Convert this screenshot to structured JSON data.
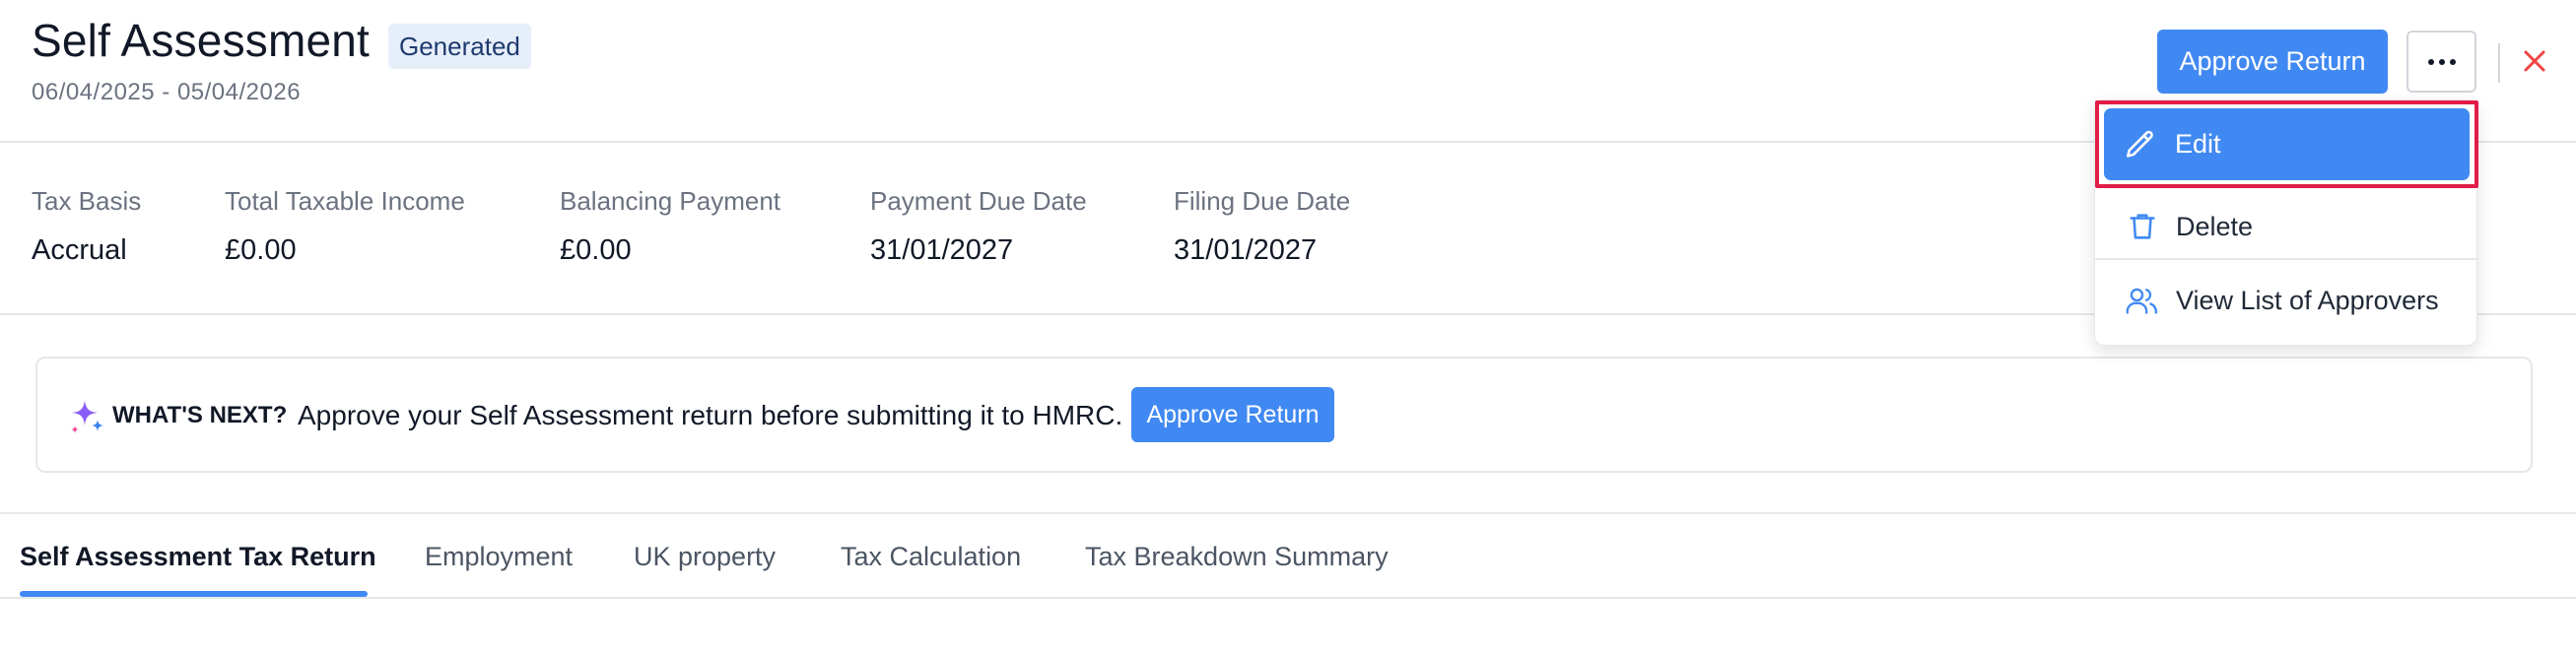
{
  "header": {
    "title": "Self Assessment",
    "status_badge": "Generated",
    "period": "06/04/2025 - 05/04/2026",
    "approve_button": "Approve Return",
    "more_icon": "more-horizontal-icon",
    "close_icon": "close-icon"
  },
  "stats": [
    {
      "label": "Tax Basis",
      "value": "Accrual"
    },
    {
      "label": "Total Taxable Income",
      "value": "£0.00"
    },
    {
      "label": "Balancing Payment",
      "value": "£0.00"
    },
    {
      "label": "Payment Due Date",
      "value": "31/01/2027"
    },
    {
      "label": "Filing Due Date",
      "value": "31/01/2027"
    }
  ],
  "banner": {
    "icon": "sparkle-icon",
    "heading": "WHAT'S NEXT?",
    "text": "Approve your Self Assessment return before submitting it to HMRC.",
    "button": "Approve Return"
  },
  "tabs": [
    {
      "label": "Self Assessment Tax Return",
      "active": true
    },
    {
      "label": "Employment",
      "active": false
    },
    {
      "label": "UK property",
      "active": false
    },
    {
      "label": "Tax Calculation",
      "active": false
    },
    {
      "label": "Tax Breakdown Summary",
      "active": false
    }
  ],
  "menu": {
    "items": [
      {
        "label": "Edit",
        "icon": "pencil-icon",
        "highlighted": true
      },
      {
        "label": "Delete",
        "icon": "trash-icon",
        "highlighted": false
      },
      {
        "label": "View List of Approvers",
        "icon": "users-icon",
        "highlighted": false
      }
    ]
  },
  "colors": {
    "primary": "#4189f2",
    "highlight_outline": "#e11d48",
    "close": "#ef4444",
    "badge_bg": "#e6eefa",
    "badge_text": "#1e3a6e",
    "sparkle": "#8b5cf6"
  }
}
